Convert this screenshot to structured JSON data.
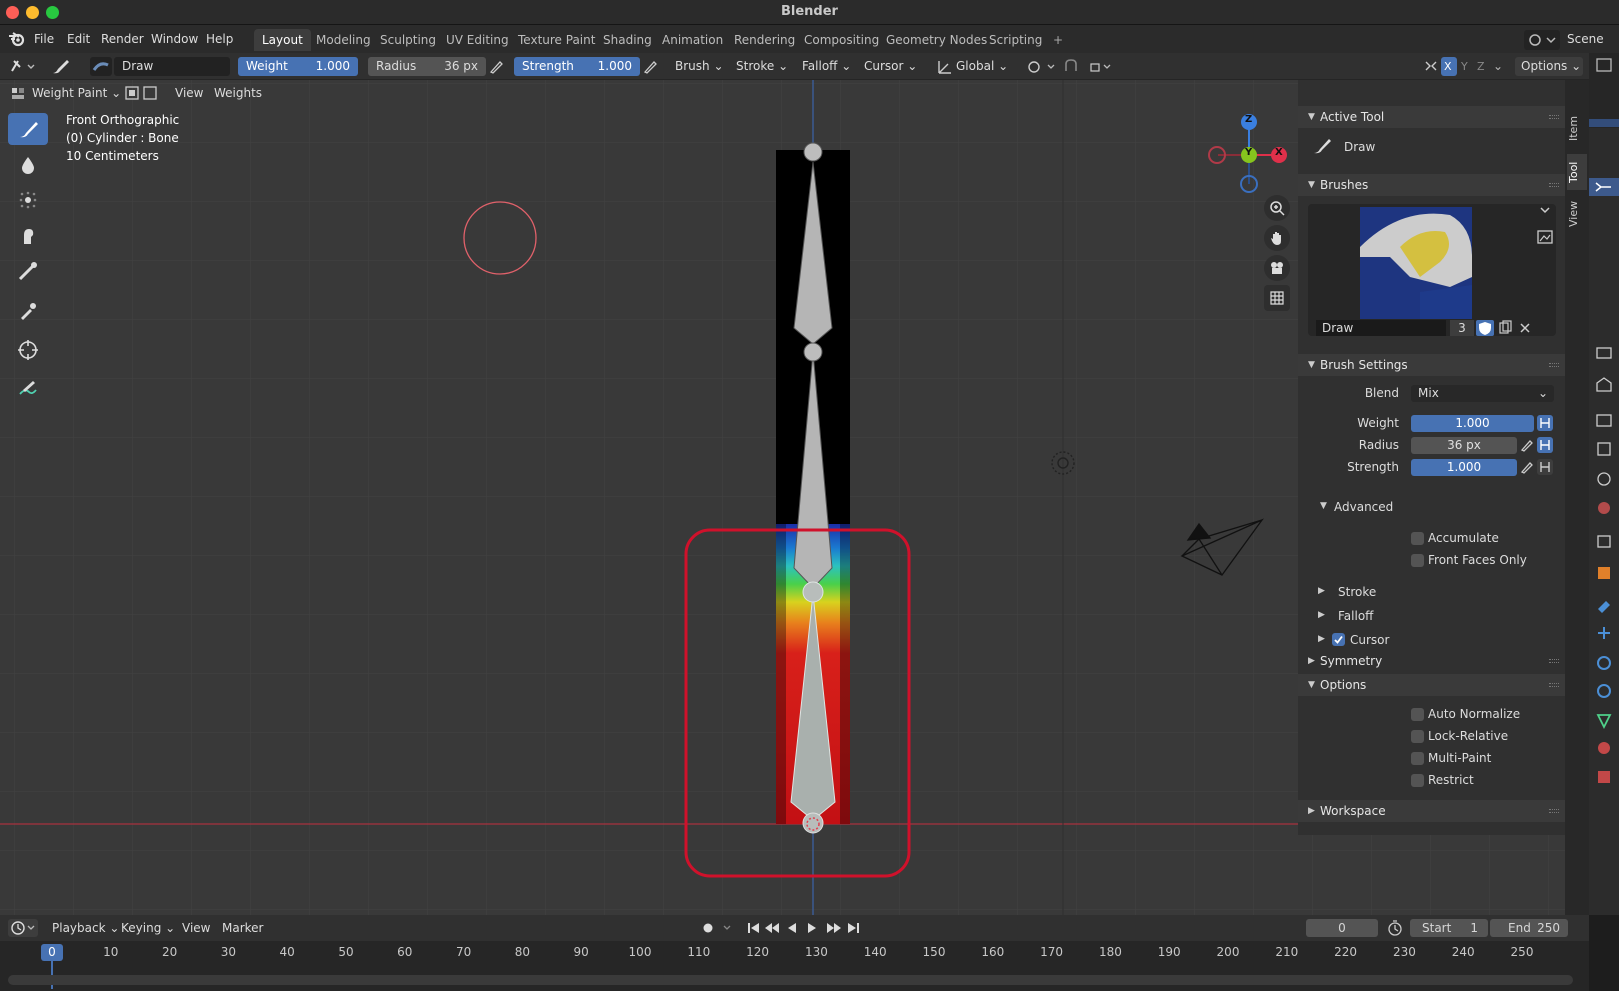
{
  "window": {
    "title": "Blender"
  },
  "menubar": {
    "menus": [
      "File",
      "Edit",
      "Render",
      "Window",
      "Help"
    ],
    "workspaces": [
      "Layout",
      "Modeling",
      "Sculpting",
      "UV Editing",
      "Texture Paint",
      "Shading",
      "Animation",
      "Rendering",
      "Compositing",
      "Geometry Nodes",
      "Scripting"
    ],
    "active_workspace": "Layout",
    "scene": "Scene"
  },
  "header": {
    "brush_name": "Draw",
    "weight_label": "Weight",
    "weight_value": "1.000",
    "radius_label": "Radius",
    "radius_value": "36 px",
    "strength_label": "Strength",
    "strength_value": "1.000",
    "dropdowns": [
      "Brush",
      "Stroke",
      "Falloff",
      "Cursor"
    ],
    "orientation": "Global",
    "options": "Options",
    "axes": [
      "X",
      "Y",
      "Z"
    ]
  },
  "viewport": {
    "mode": "Weight Paint",
    "menus": [
      "View",
      "Weights"
    ],
    "overlay_lines": [
      "Front Orthographic",
      "(0) Cylinder : Bone",
      "10 Centimeters"
    ],
    "gizmo_axes": [
      "Z",
      "Y",
      "X"
    ]
  },
  "npanel": {
    "tabs": [
      "Item",
      "Tool",
      "View"
    ],
    "active_tool": {
      "title": "Active Tool",
      "tool_name": "Draw"
    },
    "brushes": {
      "title": "Brushes",
      "brush_name": "Draw",
      "users": "3"
    },
    "brush_settings": {
      "title": "Brush Settings",
      "blend_label": "Blend",
      "blend_value": "Mix",
      "weight_label": "Weight",
      "weight_value": "1.000",
      "radius_label": "Radius",
      "radius_value": "36 px",
      "strength_label": "Strength",
      "strength_value": "1.000"
    },
    "advanced": {
      "title": "Advanced",
      "accumulate": "Accumulate",
      "front_faces_only": "Front Faces Only"
    },
    "subpanels": [
      "Stroke",
      "Falloff",
      "Cursor"
    ],
    "symmetry": "Symmetry",
    "options": {
      "title": "Options",
      "items": [
        "Auto Normalize",
        "Lock-Relative",
        "Multi-Paint",
        "Restrict"
      ]
    },
    "workspace": "Workspace"
  },
  "timeline": {
    "menus": [
      "Playback",
      "Keying",
      "View",
      "Marker"
    ],
    "current_frame": "0",
    "start_label": "Start",
    "start_value": "1",
    "end_label": "End",
    "end_value": "250",
    "ruler": [
      "0",
      "10",
      "20",
      "30",
      "40",
      "50",
      "60",
      "70",
      "80",
      "90",
      "100",
      "110",
      "120",
      "130",
      "140",
      "150",
      "160",
      "170",
      "180",
      "190",
      "200",
      "210",
      "220",
      "230",
      "240",
      "250"
    ]
  },
  "colors": {
    "accent": "#4772b3",
    "highlight_box": "#d0112b",
    "axis_x": "#e0304a",
    "axis_y": "#86c41e",
    "axis_z": "#3a7fe0"
  }
}
